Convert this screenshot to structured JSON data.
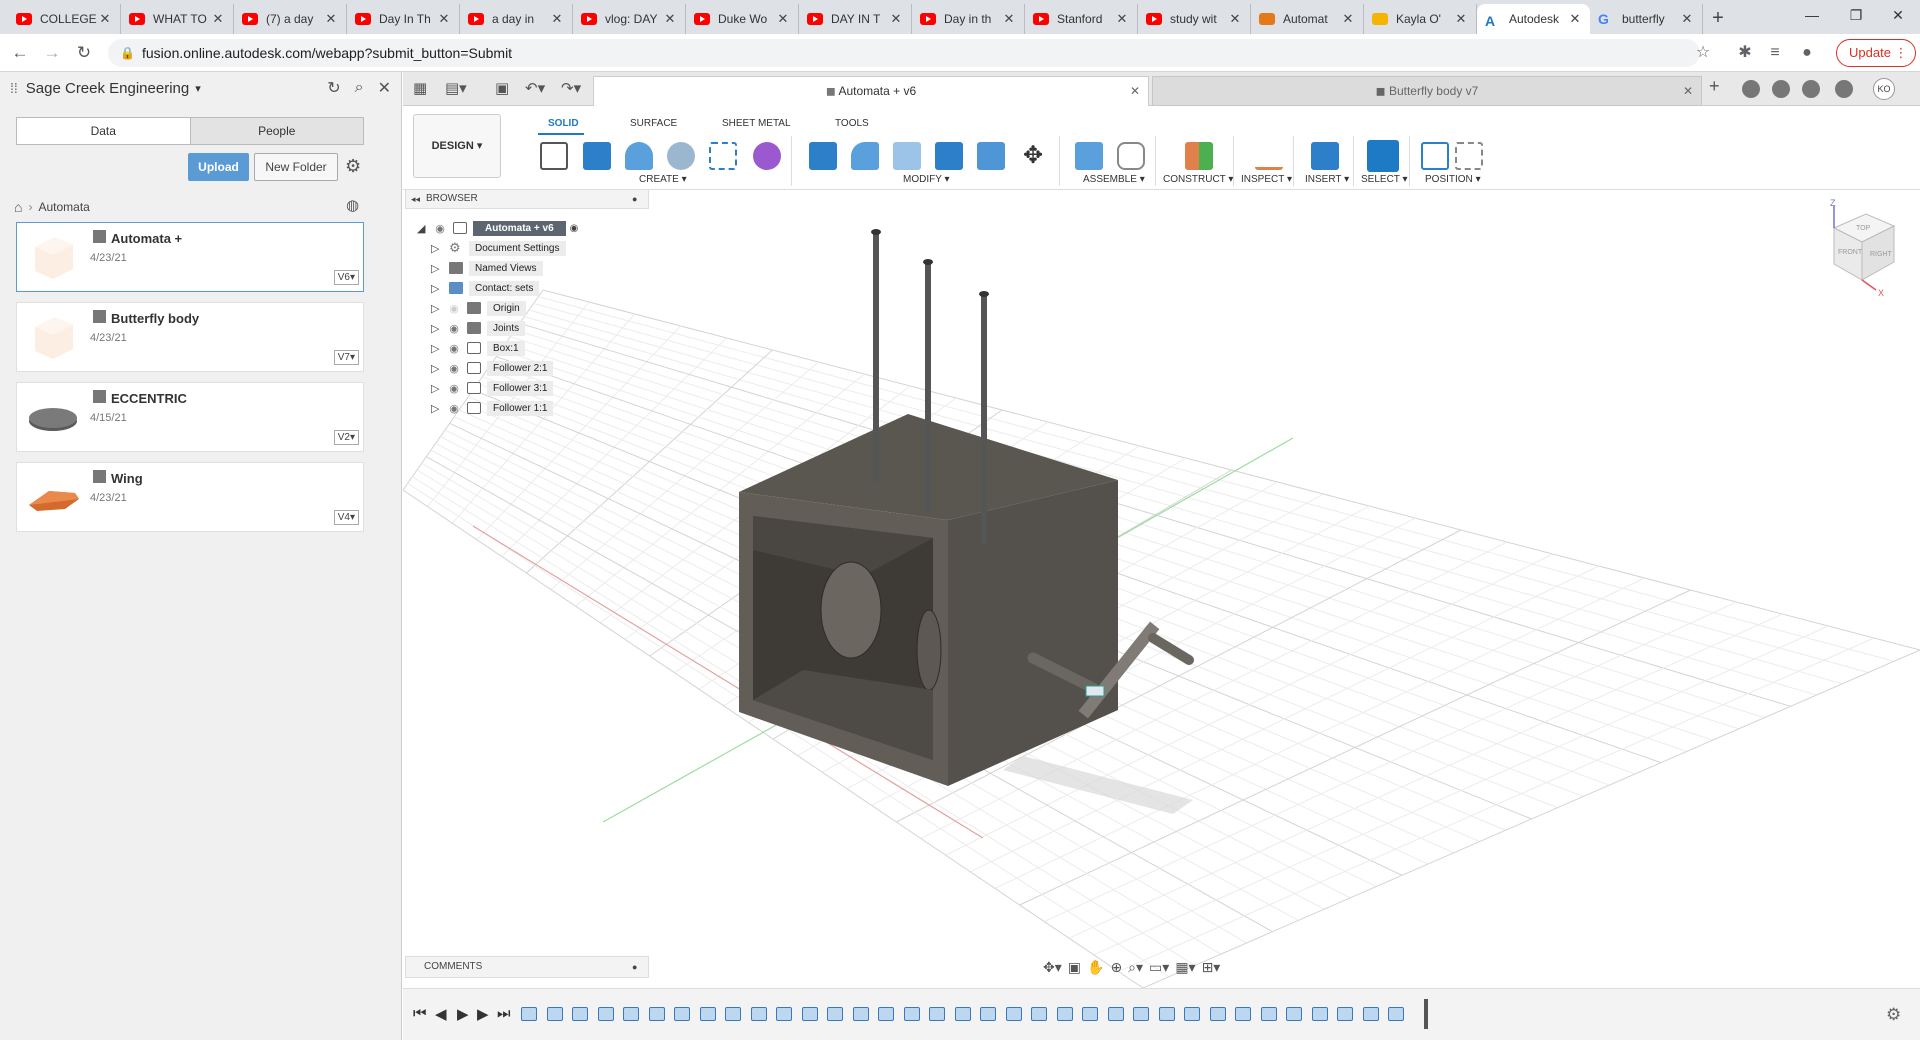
{
  "browser": {
    "tabs": [
      {
        "title": "COLLEGE",
        "icon": "youtube-icon"
      },
      {
        "title": "WHAT TO",
        "icon": "youtube-icon"
      },
      {
        "title": "(7) a day",
        "icon": "youtube-icon"
      },
      {
        "title": "Day In Th",
        "icon": "youtube-icon"
      },
      {
        "title": "a day in",
        "icon": "youtube-icon"
      },
      {
        "title": "vlog: DAY",
        "icon": "youtube-icon"
      },
      {
        "title": "Duke Wo",
        "icon": "youtube-icon"
      },
      {
        "title": "DAY IN T",
        "icon": "youtube-icon"
      },
      {
        "title": "Day in th",
        "icon": "youtube-icon"
      },
      {
        "title": "Stanford",
        "icon": "youtube-icon"
      },
      {
        "title": "study wit",
        "icon": "youtube-icon"
      },
      {
        "title": "Automat",
        "icon": "instructables-icon"
      },
      {
        "title": "Kayla O'",
        "icon": "slides-icon"
      },
      {
        "title": "Autodesk",
        "icon": "autodesk-icon",
        "active": true
      },
      {
        "title": "butterfly",
        "icon": "google-icon"
      }
    ],
    "url": "fusion.online.autodesk.com/webapp?submit_button=Submit",
    "update_label": "Update"
  },
  "data_panel": {
    "project_name": "Sage Creek Engineering",
    "tab_data": "Data",
    "tab_people": "People",
    "upload_label": "Upload",
    "new_folder_label": "New Folder",
    "breadcrumb": "Automata",
    "files": [
      {
        "name": "Automata +",
        "date": "4/23/21",
        "version": "V6"
      },
      {
        "name": "Butterfly body",
        "date": "4/23/21",
        "version": "V7"
      },
      {
        "name": "ECCENTRIC",
        "date": "4/15/21",
        "version": "V2"
      },
      {
        "name": "Wing",
        "date": "4/23/21",
        "version": "V4"
      }
    ]
  },
  "fusion": {
    "doc_tab_active": "Automata + v6",
    "doc_tab_other": "Butterfly body v7",
    "user_initials": "KO",
    "workspace_label": "DESIGN",
    "workspace_tabs": [
      "SOLID",
      "SURFACE",
      "SHEET METAL",
      "TOOLS"
    ],
    "tool_groups": [
      "CREATE",
      "MODIFY",
      "ASSEMBLE",
      "CONSTRUCT",
      "INSPECT",
      "INSERT",
      "SELECT",
      "POSITION"
    ],
    "browser_title": "BROWSER",
    "tree": [
      {
        "label": "Automata + v6",
        "root": true
      },
      {
        "label": "Document Settings"
      },
      {
        "label": "Named Views"
      },
      {
        "label": "Contact: sets"
      },
      {
        "label": "Origin"
      },
      {
        "label": "Joints"
      },
      {
        "label": "Box:1"
      },
      {
        "label": "Follower 2:1"
      },
      {
        "label": "Follower 3:1"
      },
      {
        "label": "Follower 1:1"
      }
    ],
    "comments_label": "COMMENTS",
    "viewcube": {
      "top": "TOP",
      "front": "FRONT",
      "right": "RIGHT",
      "z": "Z",
      "x": "X"
    }
  },
  "colors": {
    "accent": "#1f7ac6",
    "upload": "#5b9bd5",
    "model": "#4f4b47",
    "update": "#d93025"
  }
}
